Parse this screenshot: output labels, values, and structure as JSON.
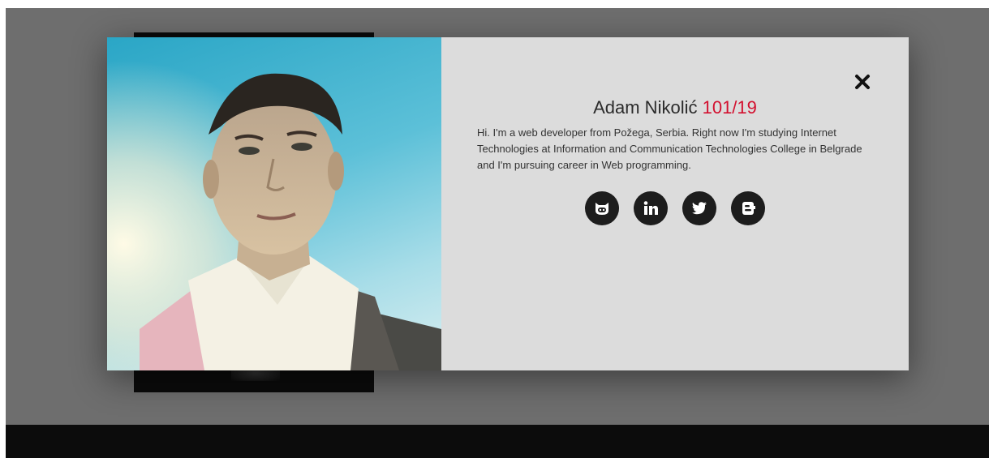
{
  "profile": {
    "name": "Adam Nikolić",
    "index": "101/19",
    "bio": "Hi. I'm a web developer from Požega, Serbia. Right now I'm studying Internet Technologies at Information and Communication Technologies College in Belgrade and I'm pursuing career in Web programming.",
    "photo_icon": "profile-photo"
  },
  "modal": {
    "close_icon": "close-icon"
  },
  "socials": [
    {
      "icon": "github-icon"
    },
    {
      "icon": "linkedin-icon"
    },
    {
      "icon": "twitter-icon"
    },
    {
      "icon": "blogger-icon"
    }
  ],
  "colors": {
    "accent": "#d3102f",
    "panel": "#dcdcdc",
    "overlay": "#6e6e6e",
    "icon_bg": "#1d1d1d"
  }
}
